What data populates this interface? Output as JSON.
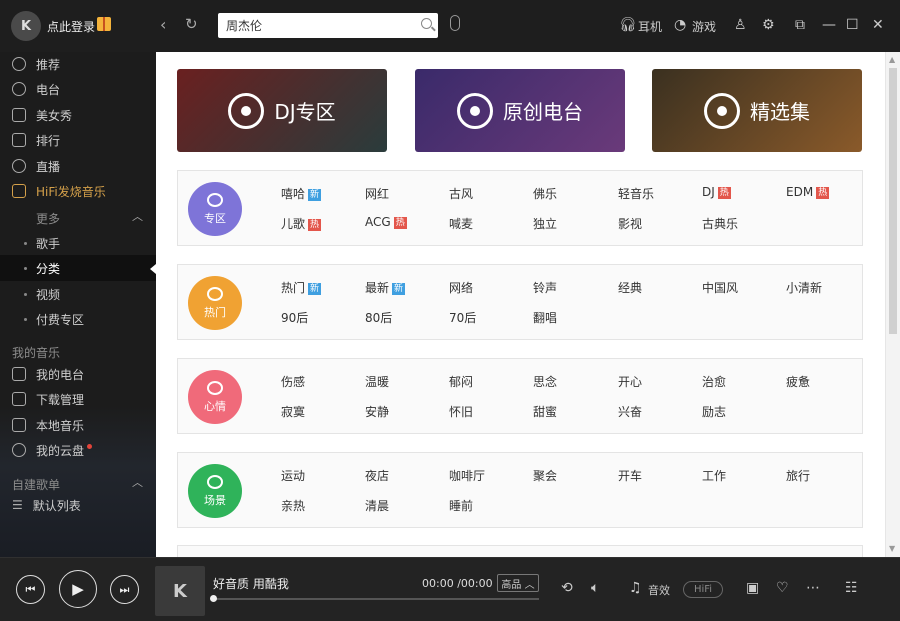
{
  "header": {
    "login_label": "点此登录",
    "search_value": "周杰伦",
    "earphone_label": "耳机",
    "game_label": "游戏"
  },
  "sidebar": {
    "items": [
      {
        "label": "推荐",
        "icon": "disc-icon"
      },
      {
        "label": "电台",
        "icon": "radio-icon"
      },
      {
        "label": "美女秀",
        "icon": "video-icon"
      },
      {
        "label": "排行",
        "icon": "chart-icon"
      },
      {
        "label": "直播",
        "icon": "mic-icon"
      },
      {
        "label": "HiFi发烧音乐",
        "icon": "hifi-icon"
      }
    ],
    "more_label": "更多",
    "sub_items": [
      "歌手",
      "分类",
      "视频",
      "付费专区"
    ],
    "my_music_label": "我的音乐",
    "my_items": [
      {
        "label": "我的电台",
        "icon": "radio-icon"
      },
      {
        "label": "下载管理",
        "icon": "download-icon"
      },
      {
        "label": "本地音乐",
        "icon": "monitor-icon"
      },
      {
        "label": "我的云盘",
        "icon": "cloud-icon"
      }
    ],
    "playlist_head": "自建歌单",
    "default_list": "默认列表"
  },
  "banners": [
    {
      "label": "DJ专区",
      "color_a": "#6a2020",
      "color_b": "#2a3c3c"
    },
    {
      "label": "原创电台",
      "color_a": "#3a2a6a",
      "color_b": "#6a3a7a"
    },
    {
      "label": "精选集",
      "color_a": "#3a3020",
      "color_b": "#8a5a2a"
    }
  ],
  "categories": [
    {
      "badge": "专区",
      "color": "#7e74d8",
      "row1": [
        {
          "t": "嘻哈",
          "m": "新"
        },
        {
          "t": "网红",
          "m": ""
        },
        {
          "t": "古风",
          "m": ""
        },
        {
          "t": "佛乐",
          "m": ""
        },
        {
          "t": "轻音乐",
          "m": ""
        },
        {
          "t": "DJ",
          "m": "热"
        },
        {
          "t": "EDM",
          "m": "热"
        }
      ],
      "row2": [
        {
          "t": "儿歌",
          "m": "热"
        },
        {
          "t": "ACG",
          "m": "热"
        },
        {
          "t": "喊麦",
          "m": ""
        },
        {
          "t": "独立",
          "m": ""
        },
        {
          "t": "影视",
          "m": ""
        },
        {
          "t": "古典乐",
          "m": ""
        }
      ]
    },
    {
      "badge": "热门",
      "color": "#f0a233",
      "row1": [
        {
          "t": "热门",
          "m": "新"
        },
        {
          "t": "最新",
          "m": "新"
        },
        {
          "t": "网络",
          "m": ""
        },
        {
          "t": "铃声",
          "m": ""
        },
        {
          "t": "经典",
          "m": ""
        },
        {
          "t": "中国风",
          "m": ""
        },
        {
          "t": "小清新",
          "m": ""
        }
      ],
      "row2": [
        {
          "t": "90后",
          "m": ""
        },
        {
          "t": "80后",
          "m": ""
        },
        {
          "t": "70后",
          "m": ""
        },
        {
          "t": "翻唱",
          "m": ""
        }
      ]
    },
    {
      "badge": "心情",
      "color": "#f06a7a",
      "row1": [
        {
          "t": "伤感",
          "m": ""
        },
        {
          "t": "温暖",
          "m": ""
        },
        {
          "t": "郁闷",
          "m": ""
        },
        {
          "t": "思念",
          "m": ""
        },
        {
          "t": "开心",
          "m": ""
        },
        {
          "t": "治愈",
          "m": ""
        },
        {
          "t": "疲惫",
          "m": ""
        }
      ],
      "row2": [
        {
          "t": "寂寞",
          "m": ""
        },
        {
          "t": "安静",
          "m": ""
        },
        {
          "t": "怀旧",
          "m": ""
        },
        {
          "t": "甜蜜",
          "m": ""
        },
        {
          "t": "兴奋",
          "m": ""
        },
        {
          "t": "励志",
          "m": ""
        }
      ]
    },
    {
      "badge": "场景",
      "color": "#2fb35a",
      "row1": [
        {
          "t": "运动",
          "m": ""
        },
        {
          "t": "夜店",
          "m": ""
        },
        {
          "t": "咖啡厅",
          "m": ""
        },
        {
          "t": "聚会",
          "m": ""
        },
        {
          "t": "开车",
          "m": ""
        },
        {
          "t": "工作",
          "m": ""
        },
        {
          "t": "旅行",
          "m": ""
        }
      ],
      "row2": [
        {
          "t": "亲热",
          "m": ""
        },
        {
          "t": "清晨",
          "m": ""
        },
        {
          "t": "睡前",
          "m": ""
        }
      ]
    }
  ],
  "player": {
    "song": "好音质 用酷我",
    "time": "00:00 /00:00",
    "quality": "高品",
    "effect_label": "音效",
    "hifi_label": "HiFi",
    "progress": 0
  }
}
